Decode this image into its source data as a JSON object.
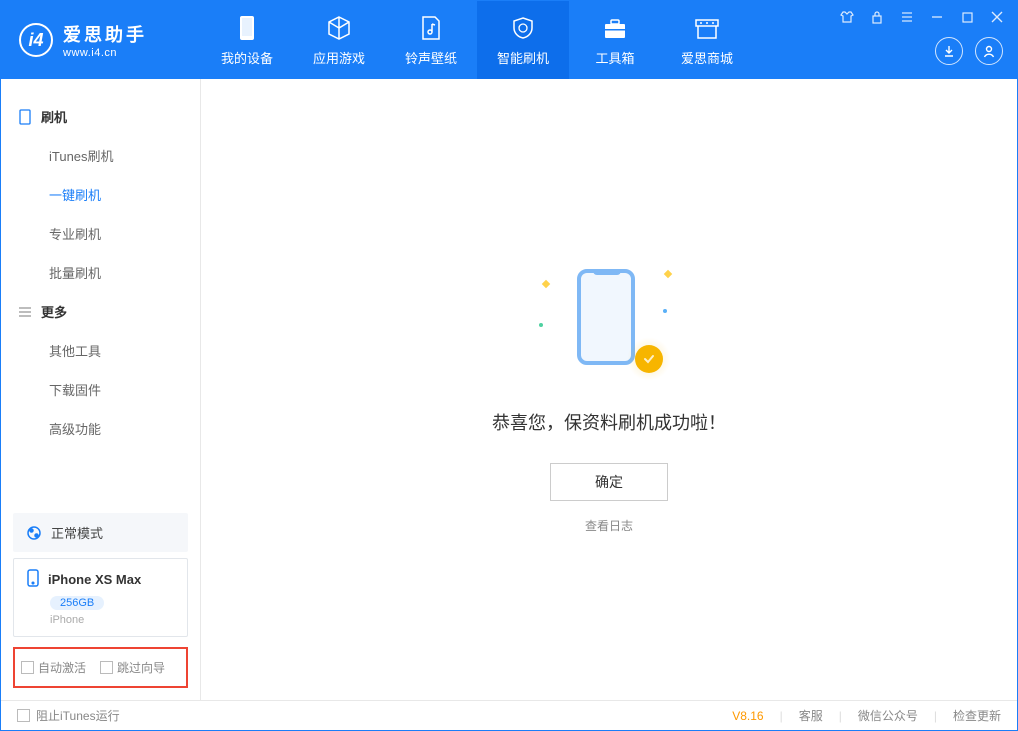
{
  "app": {
    "name": "爱思助手",
    "url": "www.i4.cn"
  },
  "nav": [
    {
      "label": "我的设备"
    },
    {
      "label": "应用游戏"
    },
    {
      "label": "铃声壁纸"
    },
    {
      "label": "智能刷机"
    },
    {
      "label": "工具箱"
    },
    {
      "label": "爱思商城"
    }
  ],
  "sidebar": {
    "section1_title": "刷机",
    "items1": [
      {
        "label": "iTunes刷机"
      },
      {
        "label": "一键刷机"
      },
      {
        "label": "专业刷机"
      },
      {
        "label": "批量刷机"
      }
    ],
    "section2_title": "更多",
    "items2": [
      {
        "label": "其他工具"
      },
      {
        "label": "下载固件"
      },
      {
        "label": "高级功能"
      }
    ],
    "mode_label": "正常模式",
    "device": {
      "name": "iPhone XS Max",
      "capacity": "256GB",
      "type": "iPhone"
    },
    "opt_auto_activate": "自动激活",
    "opt_skip_guide": "跳过向导"
  },
  "main": {
    "success_text": "恭喜您，保资料刷机成功啦！",
    "ok_label": "确定",
    "view_log": "查看日志"
  },
  "footer": {
    "block_itunes": "阻止iTunes运行",
    "version": "V8.16",
    "support": "客服",
    "wechat": "微信公众号",
    "check_update": "检查更新"
  }
}
